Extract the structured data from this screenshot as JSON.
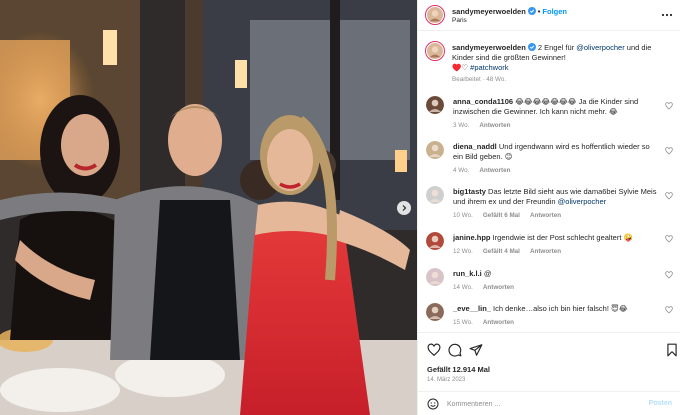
{
  "post": {
    "author": "sandymeyerwoelden",
    "location": "Paris",
    "follow_label": "Folgen",
    "caption_parts": {
      "text1": "2 Engel für ",
      "mention": "@oliverpocher",
      "text2": " und die Kinder sind die größten Gewinner!",
      "line2_emoji": "♥️♡ ",
      "hashtag": "#patchwork"
    },
    "caption_meta": "Bearbeitet · 48 Wo."
  },
  "comments": [
    {
      "user": "anna_conda1106",
      "text": "😂😂😂😂😂😂😂 Ja die Kinder sind inzwischen die Gewinner. Ich kann nicht mehr. 😂",
      "age": "3 Wo.",
      "likes": "",
      "reply": "Antworten"
    },
    {
      "user": "diena_naddl",
      "text": "Und irgendwann wird es hoffentlich wieder so ein Bild geben. 😊",
      "age": "4 Wo.",
      "likes": "",
      "reply": "Antworten"
    },
    {
      "user": "big1tasty",
      "text": "Das letzte Bild sieht aus wie dama6bei Sylvie Meis und ihrem ex und der Freundin ",
      "mention": "@oliverpocher",
      "age": "10 Wo.",
      "likes": "Gefällt 6 Mal",
      "reply": "Antworten"
    },
    {
      "user": "janine.hpp",
      "text": "Irgendwie ist der Post schlecht gealtert 🤪",
      "age": "12 Wo.",
      "likes": "Gefällt 4 Mal",
      "reply": "Antworten"
    },
    {
      "user": "run_k.l.i",
      "text": "@",
      "age": "14 Wo.",
      "likes": "",
      "reply": "Antworten"
    },
    {
      "user": "_eve__lin_",
      "text": "Ich denke…also ich bin hier falsch! 😇😂",
      "age": "15 Wo.",
      "likes": "",
      "reply": "Antworten"
    }
  ],
  "footer": {
    "likes": "Gefällt 12.914 Mal",
    "date": "14. März 2023",
    "comment_placeholder": "Kommentieren ...",
    "post_label": "Posten"
  },
  "icons": {
    "more": "more-horizontal-icon",
    "heart": "heart-icon",
    "comment": "comment-icon",
    "share": "share-icon",
    "save": "bookmark-icon",
    "emoji": "emoji-icon",
    "verified": "verified-badge-icon",
    "carousel_next": "chevron-right-icon"
  },
  "colors": {
    "accent": "#0095f6",
    "verified": "#3897f0",
    "muted": "#8e8e8e",
    "mention": "#00376b"
  }
}
